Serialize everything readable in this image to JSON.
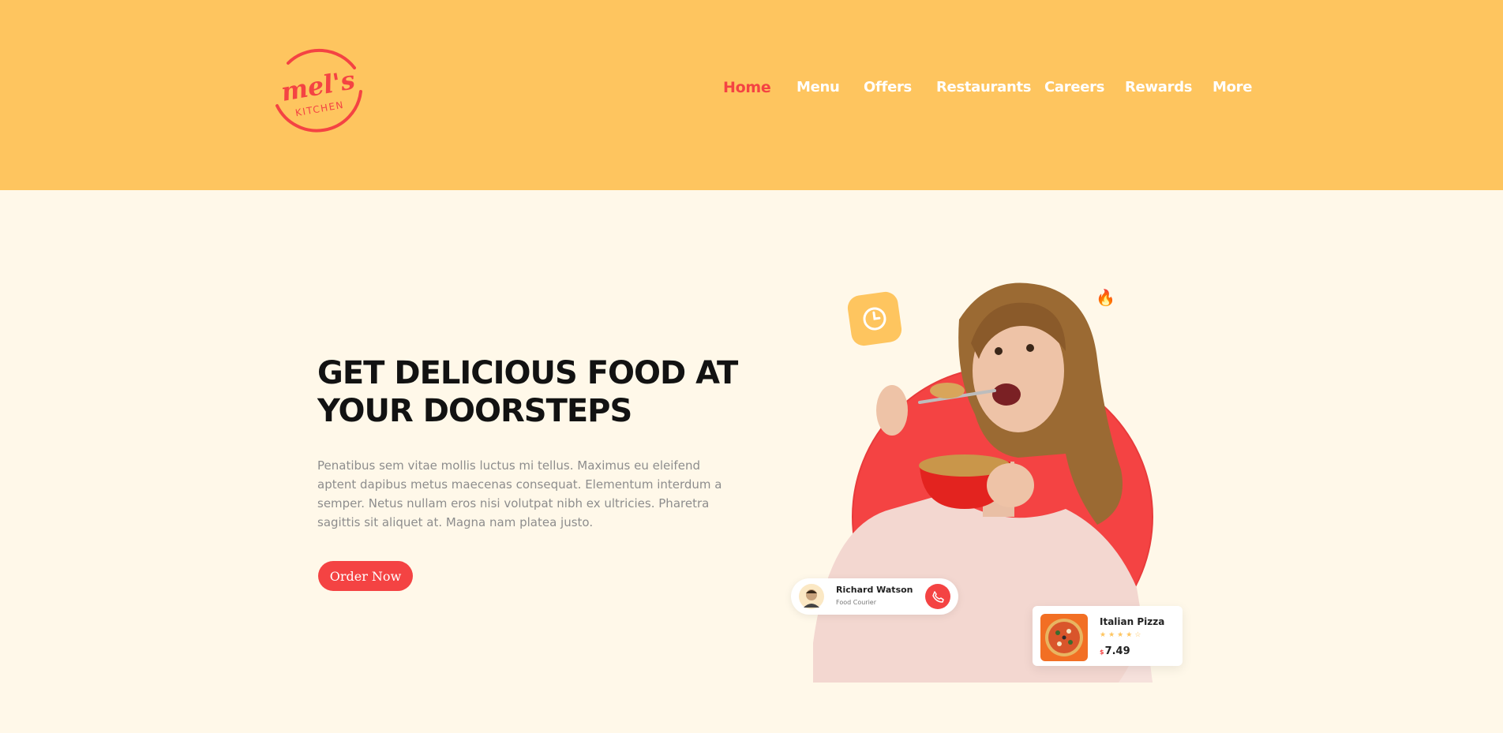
{
  "brand": {
    "logo_word": "mel's",
    "logo_sub": "KITCHEN",
    "primary_color": "#f44343",
    "header_color": "#fec55f",
    "background_color": "#fff8e9"
  },
  "nav": {
    "items": [
      {
        "label": "Home",
        "active": true
      },
      {
        "label": "Menu"
      },
      {
        "label": "Offers"
      },
      {
        "label": "Restaurants"
      },
      {
        "label": "Careers"
      },
      {
        "label": "Rewards"
      },
      {
        "label": "More"
      }
    ]
  },
  "hero": {
    "title_line1": "GET DELICIOUS FOOD AT",
    "title_line2": "YOUR DOORSTEPS",
    "text": "Penatibus sem vitae mollis luctus mi tellus. Maximus eu eleifend aptent dapibus metus maecenas consequat. Elementum interdum a semper. Netus nullam eros nisi volutpat nibh ex ultricies. Pharetra sagittis sit aliquet at. Magna nam platea justo.",
    "cta_label": "Order Now"
  },
  "illustration": {
    "subject": "woman-eating-cereal",
    "clock_icon": "clock-icon",
    "fire_icon": "fire-icon"
  },
  "courier": {
    "name": "Richard Watson",
    "role": "Food Courier",
    "call_icon": "phone-icon"
  },
  "product": {
    "name": "Italian Pizza",
    "rating": 4,
    "rating_max": 5,
    "currency": "$",
    "price": "7.49"
  }
}
